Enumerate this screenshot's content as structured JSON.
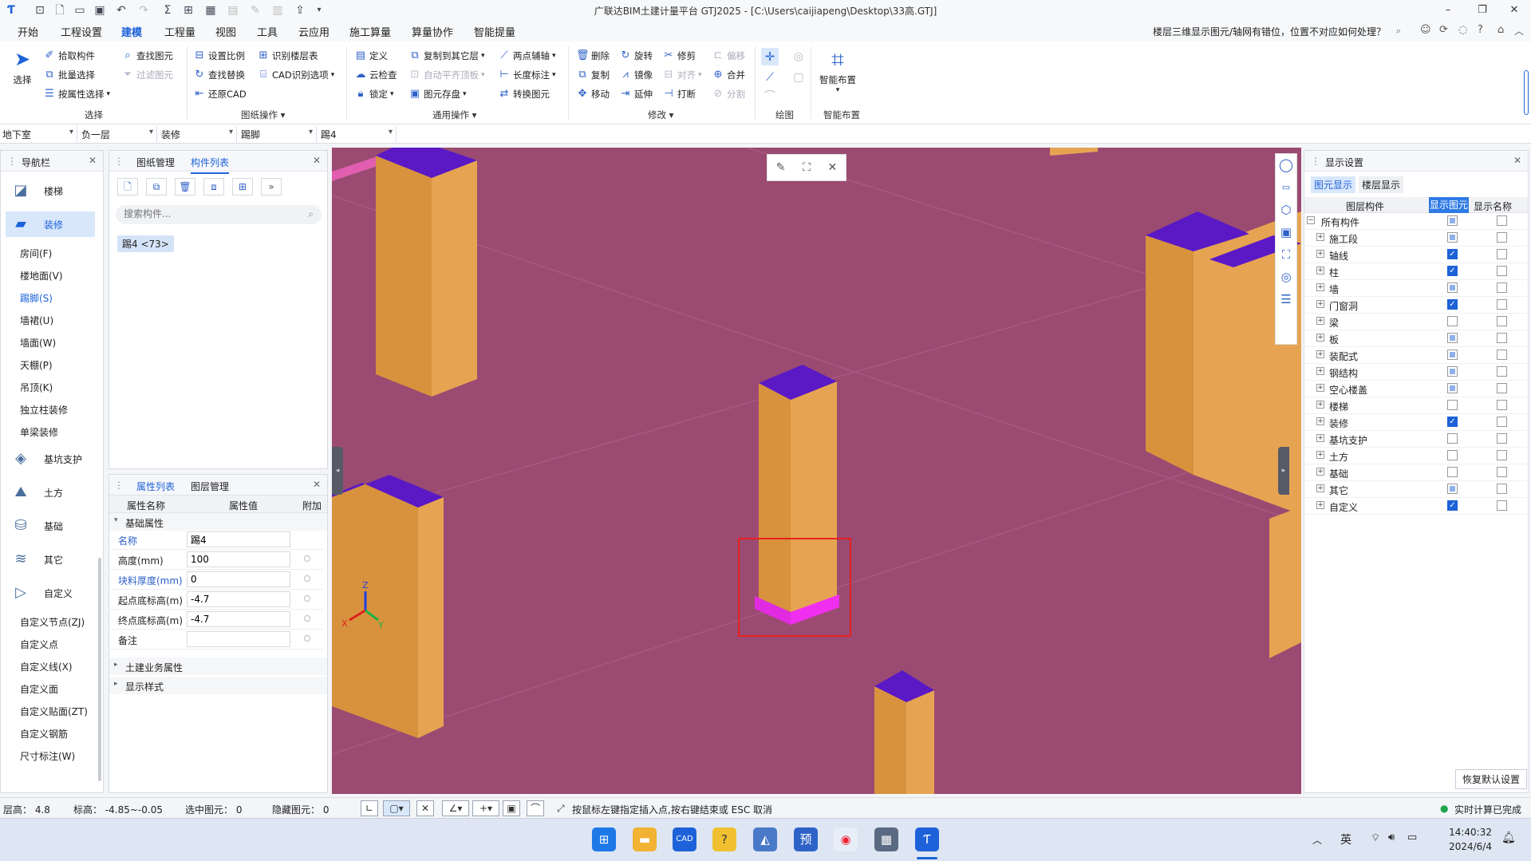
{
  "title": "广联达BIM土建计量平台 GTJ2025 - [C:\\Users\\caijiapeng\\Desktop\\33高.GTJ]",
  "menu": [
    "开始",
    "工程设置",
    "建模",
    "工程量",
    "视图",
    "工具",
    "云应用",
    "施工算量",
    "算量协作",
    "智能提量"
  ],
  "help_question": "楼层三维显示图元/轴网有错位，位置不对应如何处理？",
  "ribbon": {
    "select": "选择",
    "pick": "拾取构件",
    "batch": "批量选择",
    "byattr": "按属性选择",
    "find": "查找图元",
    "filter": "过滤图元",
    "setscale": "设置比例",
    "findreplace": "查找替换",
    "restore": "还原CAD",
    "idfloor": "识别楼层表",
    "cadopt": "CAD识别选项",
    "define": "定义",
    "cloudcheck": "云检查",
    "lock": "锁定",
    "copyto": "复制到其它层",
    "autoflat": "自动平齐顶板",
    "saveelem": "图元存盘",
    "twopoint": "两点辅轴",
    "lengthmark": "长度标注",
    "convert": "转换图元",
    "delete": "删除",
    "copy": "复制",
    "move": "移动",
    "rotate": "旋转",
    "mirror": "镜像",
    "extend": "延伸",
    "trim": "修剪",
    "align": "对齐",
    "break": "打断",
    "offset": "偏移",
    "merge": "合并",
    "split": "分割",
    "smart": "智能布置",
    "g_select": "选择",
    "g_drawing": "图纸操作",
    "g_common": "通用操作",
    "g_modify": "修改",
    "g_draw": "绘图",
    "g_smart": "智能布置"
  },
  "selectors": [
    "地下室",
    "负一层",
    "装修",
    "踢脚",
    "踢4"
  ],
  "nav": {
    "title": "导航栏",
    "big": [
      "楼梯",
      "装修",
      "基坑支护",
      "土方",
      "基础",
      "其它",
      "自定义"
    ],
    "deco_subs": [
      "房间(F)",
      "楼地面(V)",
      "踢脚(S)",
      "墙裙(U)",
      "墙面(W)",
      "天棚(P)",
      "吊顶(K)",
      "独立柱装修",
      "单梁装修"
    ],
    "custom_subs": [
      "自定义节点(ZJ)",
      "自定义点",
      "自定义线(X)",
      "自定义面",
      "自定义贴面(ZT)",
      "自定义钢筋",
      "尺寸标注(W)"
    ]
  },
  "complist": {
    "tab1": "图纸管理",
    "tab2": "构件列表",
    "search_placeholder": "搜索构件...",
    "item": "踢4 <73>"
  },
  "props": {
    "tab1": "属性列表",
    "tab2": "图层管理",
    "col_name": "属性名称",
    "col_value": "属性值",
    "col_extra": "附加",
    "group_basic": "基础属性",
    "rows": [
      {
        "name": "名称",
        "value": "踢4",
        "blue": true
      },
      {
        "name": "高度(mm)",
        "value": "100",
        "blue": false
      },
      {
        "name": "块料厚度(mm)",
        "value": "0",
        "blue": true
      },
      {
        "name": "起点底标高(m)",
        "value": "-4.7",
        "blue": false
      },
      {
        "name": "终点底标高(m)",
        "value": "-4.7",
        "blue": false
      },
      {
        "name": "备注",
        "value": "",
        "blue": false
      }
    ],
    "group_civil": "土建业务属性",
    "group_style": "显示样式"
  },
  "display": {
    "title": "显示设置",
    "tab1": "图元显示",
    "tab2": "楼层显示",
    "col1": "图层构件",
    "col2": "显示图元",
    "col3": "显示名称",
    "all": "所有构件",
    "rows": [
      {
        "name": "施工段",
        "show": "part",
        "label": false
      },
      {
        "name": "轴线",
        "show": "on",
        "label": false
      },
      {
        "name": "柱",
        "show": "on",
        "label": false
      },
      {
        "name": "墙",
        "show": "part",
        "label": false
      },
      {
        "name": "门窗洞",
        "show": "on",
        "label": false
      },
      {
        "name": "梁",
        "show": "off",
        "label": false
      },
      {
        "name": "板",
        "show": "part",
        "label": false
      },
      {
        "name": "装配式",
        "show": "part",
        "label": false
      },
      {
        "name": "钢结构",
        "show": "part",
        "label": false
      },
      {
        "name": "空心楼盖",
        "show": "part",
        "label": false
      },
      {
        "name": "楼梯",
        "show": "off",
        "label": false
      },
      {
        "name": "装修",
        "show": "on",
        "label": false
      },
      {
        "name": "基坑支护",
        "show": "off",
        "label": false
      },
      {
        "name": "土方",
        "show": "off",
        "label": false
      },
      {
        "name": "基础",
        "show": "off",
        "label": false
      },
      {
        "name": "其它",
        "show": "part",
        "label": false
      },
      {
        "name": "自定义",
        "show": "on",
        "label": false
      }
    ],
    "restore": "恢复默认设置"
  },
  "status": {
    "floor_height": "层高：  4.8",
    "elevation": "标高：  -4.85~-0.05",
    "selected": "选中图元：  0",
    "hidden": "隐藏图元：  0",
    "hint": "按鼠标左键指定插入点,按右键结束或 ESC 取消",
    "realtime": "实时计算已完成"
  },
  "taskbar": {
    "ime": "英",
    "time": "14:40:32",
    "date": "2024/6/4"
  },
  "colors": {
    "accent": "#1d62d8",
    "viewport_bg": "#9b4b71",
    "column_side": "#e2a04e",
    "column_top": "#5a19c5",
    "skirting": "#e02be0",
    "highlight_box": "#e8201e"
  }
}
